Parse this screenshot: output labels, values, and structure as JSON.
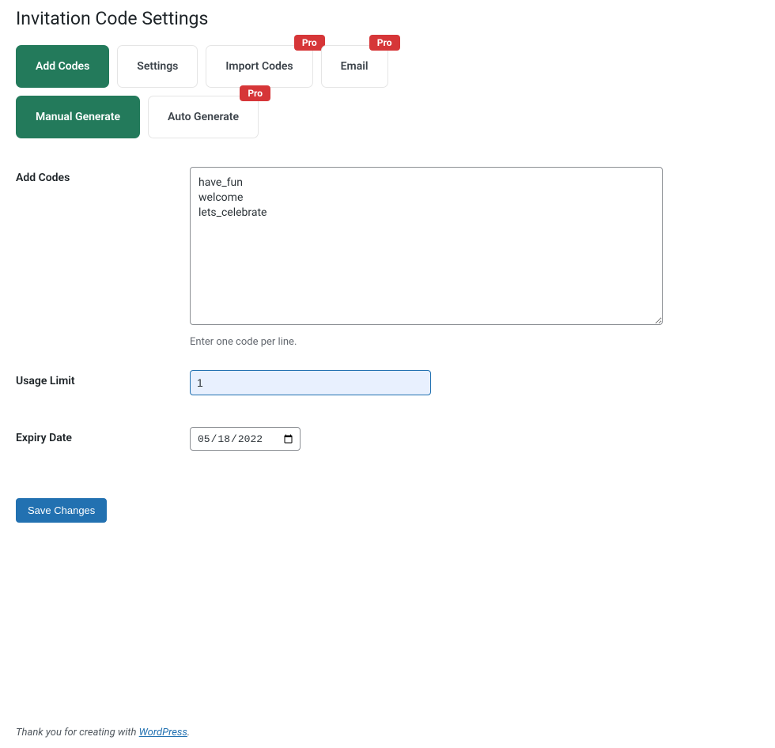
{
  "page_title": "Invitation Code Settings",
  "pro_label": "Pro",
  "tabs_primary": [
    {
      "label": "Add Codes",
      "active": true,
      "pro": false
    },
    {
      "label": "Settings",
      "active": false,
      "pro": false
    },
    {
      "label": "Import Codes",
      "active": false,
      "pro": true
    },
    {
      "label": "Email",
      "active": false,
      "pro": true
    }
  ],
  "tabs_secondary": [
    {
      "label": "Manual Generate",
      "active": true,
      "pro": false
    },
    {
      "label": "Auto Generate",
      "active": false,
      "pro": true
    }
  ],
  "form": {
    "add_codes": {
      "label": "Add Codes",
      "value": "have_fun\nwelcome\nlets_celebrate",
      "help": "Enter one code per line."
    },
    "usage_limit": {
      "label": "Usage Limit",
      "value": "1"
    },
    "expiry_date": {
      "label": "Expiry Date",
      "value": "2022-05-18",
      "display": "05/18/2022"
    }
  },
  "save_button": "Save Changes",
  "footer": {
    "prefix": "Thank you for creating with ",
    "link_text": "WordPress",
    "suffix": "."
  }
}
